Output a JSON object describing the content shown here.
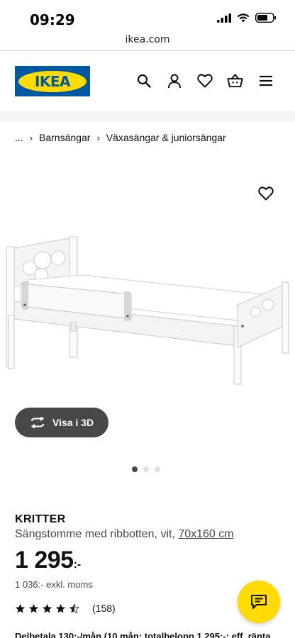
{
  "status_bar": {
    "time": "09:29"
  },
  "browser": {
    "url": "ikea.com"
  },
  "header": {
    "logo_text": "IKEA",
    "icons": [
      "search-icon",
      "user-icon",
      "heart-icon",
      "basket-icon",
      "menu-icon"
    ]
  },
  "breadcrumb": {
    "ellipsis": "...",
    "items": [
      "Barnsängar",
      "Växasängar & juniorsängar"
    ]
  },
  "gallery": {
    "view3d_label": "Visa i 3D",
    "dot_count": 3,
    "active_dot": 0
  },
  "product": {
    "name": "KRITTER",
    "description": "Sängstomme med ribbotten, vit, ",
    "size": "70x160 cm",
    "price_main": "1 295",
    "price_suffix": ":-",
    "ex_vat": "1 036:- exkl. moms",
    "rating": 4.5,
    "review_count": "(158)",
    "installment": "Delbetala 130:-/mån (10 mån; totalbelopp 1 295:-; eff. ränta"
  },
  "colors": {
    "ikea_blue": "#0058a3",
    "ikea_yellow": "#ffdb00",
    "dark_button": "#484848"
  }
}
